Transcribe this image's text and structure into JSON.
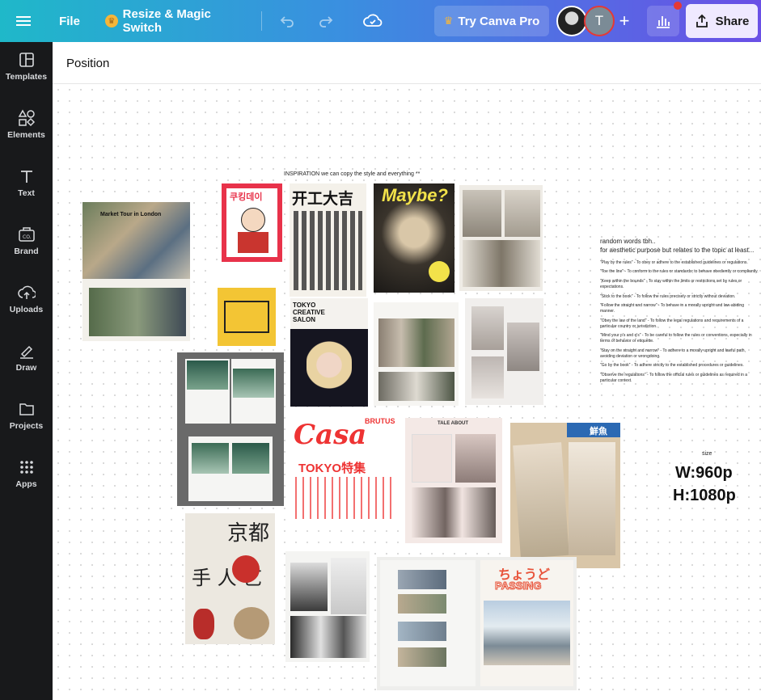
{
  "topbar": {
    "file_label": "File",
    "resize_label": "Resize & Magic Switch",
    "try_pro_label": "Try Canva Pro",
    "avatar_initial": "T",
    "share_label": "Share"
  },
  "sidebar": {
    "items": [
      {
        "label": "Templates",
        "icon": "templates-icon"
      },
      {
        "label": "Elements",
        "icon": "elements-icon"
      },
      {
        "label": "Text",
        "icon": "text-icon"
      },
      {
        "label": "Brand",
        "icon": "brand-icon"
      },
      {
        "label": "Uploads",
        "icon": "uploads-icon"
      },
      {
        "label": "Draw",
        "icon": "draw-icon"
      },
      {
        "label": "Projects",
        "icon": "projects-icon"
      },
      {
        "label": "Apps",
        "icon": "apps-icon"
      }
    ]
  },
  "panel": {
    "title": "Position"
  },
  "canvas": {
    "inspiration_text": "INSPIRATION      we can copy the style and everything **",
    "notes": {
      "title1": "random words tbh..",
      "title2": "for aesthetic purpose but relates to the topic at least...",
      "lines": [
        "\"Play by the rules\" - To obey or adhere to the established guidelines or regulations.",
        "\"Toe the line\" - To conform to the rules or standards; to behave obediently or compliantly.",
        "\"Keep within the bounds\" - To stay within the limits or restrictions set by rules or expectations.",
        "\"Stick to the book\" - To follow the rules precisely or strictly without deviation.",
        "\"Follow the straight and narrow\" - To behave in a morally upright and law-abiding manner.",
        "\"Obey the law of the land\" - To follow the legal regulations and requirements of a particular country or jurisdiction.",
        "\"Mind your p's and q's\" - To be careful to follow the rules or conventions, especially in terms of behavior or etiquette.",
        "\"Stay on the straight and narrow\" - To adhere to a morally upright and lawful path, avoiding deviation or wrongdoing.",
        "\"Go by the book\" - To adhere strictly to the established procedures or guidelines.",
        "\"Observe the regulations\" - To follow the official rules or guidelines as required in a particular context."
      ]
    },
    "size_label": "size",
    "width_label": "W:960p",
    "height_label": "H:1080p",
    "magazine_texts": {
      "london": "Market Tour in London",
      "korean": "쿠킹데이",
      "kaiko": "开工大吉",
      "maybe": "Maybe?",
      "tokyo_salon": "TOKYO CREATIVE SALON",
      "casa": "Casa",
      "brutus": "BRUTUS",
      "tokyo_special": "TOKYO特集",
      "kyoto": "京都",
      "craftsman": "手 人 艺",
      "passing_jp": "ちょうど",
      "passing": "PASSING",
      "tale": "TALE ABOUT",
      "fish": "鮮魚"
    }
  }
}
